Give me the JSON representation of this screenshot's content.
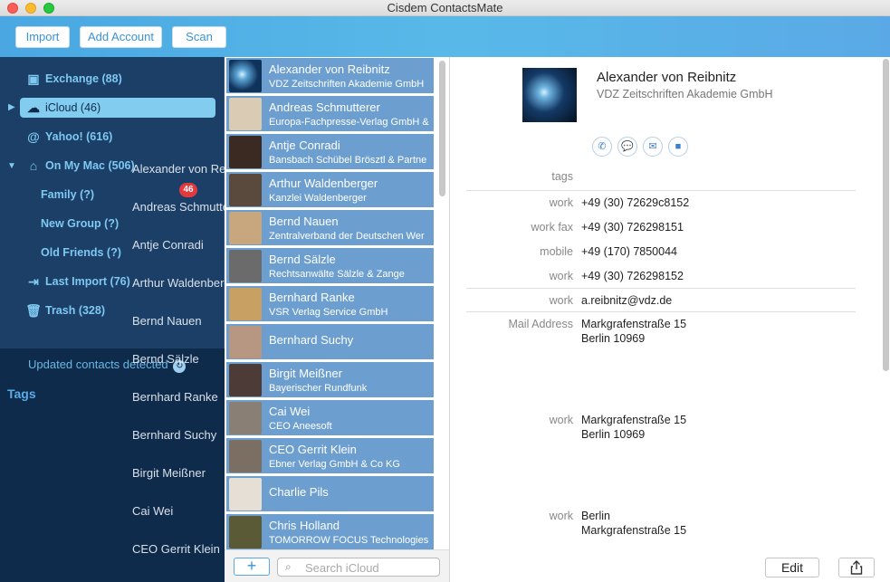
{
  "window": {
    "title": "Cisdem ContactsMate"
  },
  "toolbar": {
    "import": "Import",
    "add_account": "Add Account",
    "scan": "Scan"
  },
  "sidebar": {
    "accounts": [
      {
        "label": "Exchange (88)",
        "icon": "exchange-icon",
        "glyph": "▣"
      },
      {
        "label": "iCloud (46)",
        "icon": "cloud-icon",
        "glyph": "☁"
      },
      {
        "label": "Yahoo! (616)",
        "icon": "at-icon",
        "glyph": "@"
      },
      {
        "label": "On My Mac (506)",
        "icon": "house-icon",
        "glyph": "⌂"
      },
      {
        "label": "Family (?)"
      },
      {
        "label": "New Group (?)"
      },
      {
        "label": "Old Friends (?)"
      },
      {
        "label": "Last Import (76)",
        "icon": "import-icon",
        "glyph": "⇥"
      },
      {
        "label": "Trash (328)",
        "icon": "trash-icon",
        "glyph": "🗑"
      }
    ],
    "updated_notice": "Updated contacts detected",
    "tags_heading": "Tags",
    "drag_count": "46",
    "drag_names": [
      "Alexander von Reibnitz",
      "Andreas Schmutterer",
      "Antje Conradi",
      "Arthur Waldenberger",
      "Bernd Nauen",
      "Bernd Sälzle",
      "Bernhard Ranke",
      "Bernhard Suchy",
      "Birgit Meißner",
      "Cai Wei",
      "CEO Gerrit Klein"
    ]
  },
  "contacts": [
    {
      "name": "Alexander von Reibnitz",
      "company": "VDZ Zeitschriften Akademie GmbH",
      "avatar": "#2a5d8c"
    },
    {
      "name": "Andreas Schmutterer",
      "company": "Europa-Fachpresse-Verlag GmbH &",
      "avatar": "#d9cbb4"
    },
    {
      "name": "Antje Conradi",
      "company": "Bansbach Schübel Brösztl & Partne",
      "avatar": "#3b2a22"
    },
    {
      "name": "Arthur Waldenberger",
      "company": "Kanzlei Waldenberger",
      "avatar": "#5a4a3e"
    },
    {
      "name": "Bernd Nauen",
      "company": "Zentralverband der Deutschen Wer",
      "avatar": "#c8a77e"
    },
    {
      "name": "Bernd Sälzle",
      "company": "Rechtsanwälte Sälzle & Zange",
      "avatar": "#6b6b6b"
    },
    {
      "name": "Bernhard Ranke",
      "company": "VSR Verlag Service GmbH",
      "avatar": "#c9a063"
    },
    {
      "name": "Bernhard Suchy",
      "company": "",
      "avatar": "#b79682"
    },
    {
      "name": "Birgit Meißner",
      "company": "Bayerischer Rundfunk",
      "avatar": "#4c3b36"
    },
    {
      "name": "Cai Wei",
      "company": "CEO Aneesoft",
      "avatar": "#8a7f74"
    },
    {
      "name": "CEO Gerrit Klein",
      "company": "Ebner Verlag GmbH & Co KG",
      "avatar": "#7b6e63"
    },
    {
      "name": "Charlie Pils",
      "company": "",
      "avatar": "#e6dfd6"
    },
    {
      "name": "Chris Holland",
      "company": "TOMORROW FOCUS Technologies",
      "avatar": "#5b5a37"
    }
  ],
  "search": {
    "placeholder": "Search iCloud"
  },
  "detail": {
    "name": "Alexander von Reibnitz",
    "company": "VDZ Zeitschriften Akademie GmbH",
    "tags_label": "tags",
    "phones": [
      {
        "label": "work",
        "value": "+49 (30) 72629c8152"
      },
      {
        "label": "work fax",
        "value": "+49 (30) 726298151"
      },
      {
        "label": "mobile",
        "value": "+49 (170) 7850044"
      },
      {
        "label": "work",
        "value": "+49 (30) 726298152"
      }
    ],
    "email": {
      "label": "work",
      "value": "a.reibnitz@vdz.de"
    },
    "addresses": [
      {
        "label": "Mail Address",
        "line1": "Markgrafenstraße 15",
        "line2": "Berlin 10969"
      },
      {
        "label": "work",
        "line1": "Markgrafenstraße 15",
        "line2": "Berlin 10969"
      },
      {
        "label": "work",
        "line1": "Berlin",
        "line2": "Markgrafenstraße 15"
      }
    ],
    "edit": "Edit",
    "actions": {
      "call": "✆",
      "message": "💬",
      "email": "✉",
      "video": "■"
    }
  },
  "colors": {
    "accent": "#4aa7e2",
    "sidebar": "#1b3f66",
    "row": "#6c9fd0"
  }
}
